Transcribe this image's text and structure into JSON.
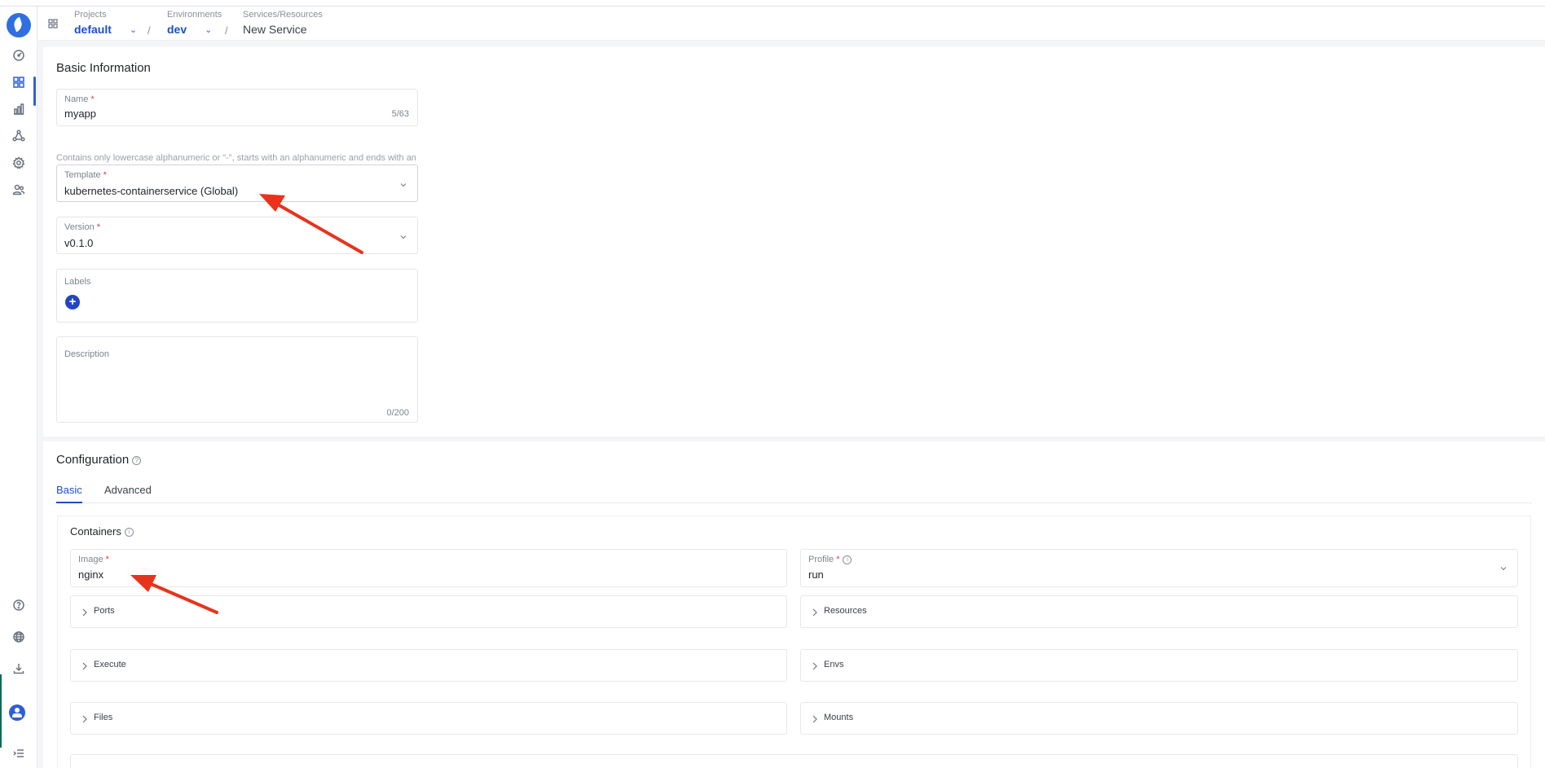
{
  "breadcrumb": {
    "projects_caption": "Projects",
    "project_value": "default",
    "environments_caption": "Environments",
    "environment_value": "dev",
    "services_caption": "Services/Resources",
    "service_value": "New Service",
    "separator": "/"
  },
  "basic": {
    "title": "Basic Information",
    "name_label": "Name",
    "name_value": "myapp",
    "name_count": "5/63",
    "name_help": "Contains only lowercase alphanumeric or \"-\", starts with an alphanumeric and ends with an alphanumeric.",
    "template_label": "Template",
    "template_value": "kubernetes-containerservice (Global)",
    "version_label": "Version",
    "version_value": "v0.1.0",
    "labels_label": "Labels",
    "add_label_glyph": "+",
    "description_label": "Description",
    "description_count": "0/200",
    "required_mark": "*"
  },
  "configuration": {
    "title": "Configuration",
    "help_glyph": "?",
    "tabs": [
      {
        "label": "Basic"
      },
      {
        "label": "Advanced"
      }
    ],
    "containers_title": "Containers",
    "info_glyph": "i",
    "image_label": "Image",
    "image_value": "nginx",
    "profile_label": "Profile",
    "profile_value": "run",
    "sections": [
      {
        "label": "Ports"
      },
      {
        "label": "Resources"
      },
      {
        "label": "Execute"
      },
      {
        "label": "Envs"
      },
      {
        "label": "Files"
      },
      {
        "label": "Mounts"
      }
    ]
  },
  "colors": {
    "accent": "#1d4fc4",
    "annotation_arrow": "#e8321c",
    "required": "#e13b3b"
  }
}
